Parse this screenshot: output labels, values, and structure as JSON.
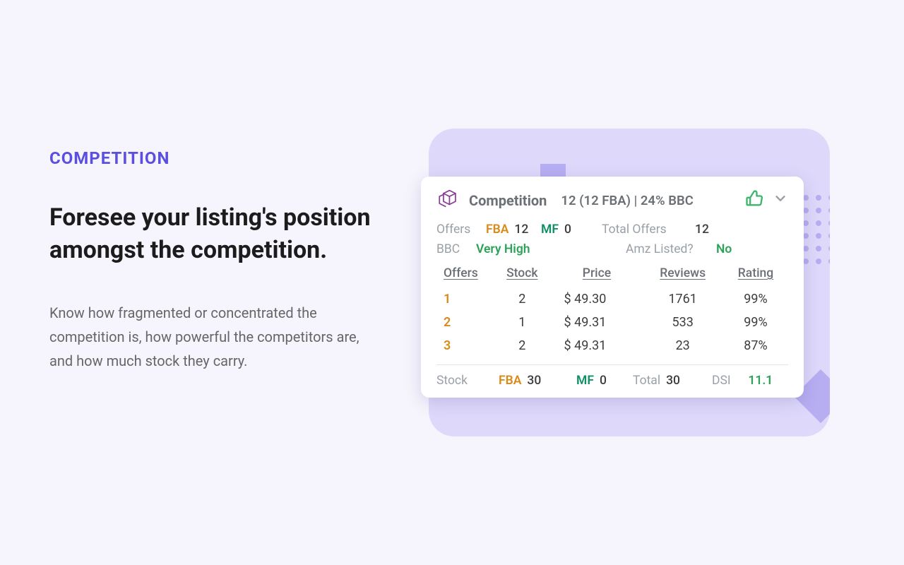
{
  "left": {
    "eyebrow": "COMPETITION",
    "headline": "Foresee your listing's position amongst the competition.",
    "body": "Know how fragmented or concentrated the competition is, how powerful the competitors are, and how much stock they carry."
  },
  "card": {
    "title": "Competition",
    "summary": "12 (12 FBA)  | 24% BBC",
    "offers_label": "Offers",
    "fba_label": "FBA",
    "fba_value": "12",
    "mf_label": "MF",
    "mf_value": "0",
    "total_offers_label": "Total Offers",
    "total_offers_value": "12",
    "bbc_label": "BBC",
    "bbc_value": "Very High",
    "amz_listed_label": "Amz Listed?",
    "amz_listed_value": "No",
    "columns": {
      "offers": "Offers",
      "stock": "Stock",
      "price": "Price",
      "reviews": "Reviews",
      "rating": "Rating"
    },
    "rows": [
      {
        "offer": "1",
        "stock": "2",
        "price": "$ 49.30",
        "reviews": "1761",
        "rating": "99%"
      },
      {
        "offer": "2",
        "stock": "1",
        "price": "$ 49.31",
        "reviews": "533",
        "rating": "99%"
      },
      {
        "offer": "3",
        "stock": "2",
        "price": "$ 49.31",
        "reviews": "23",
        "rating": "87%"
      }
    ],
    "foot": {
      "stock_label": "Stock",
      "fba_label": "FBA",
      "fba_value": "30",
      "mf_label": "MF",
      "mf_value": "0",
      "total_label": "Total",
      "total_value": "30",
      "dsi_label": "DSI",
      "dsi_value": "11.1"
    }
  },
  "colors": {
    "accent": "#5b4fe0",
    "fba": "#d98a19",
    "mf": "#0e8f66",
    "positive": "#2da35a"
  }
}
